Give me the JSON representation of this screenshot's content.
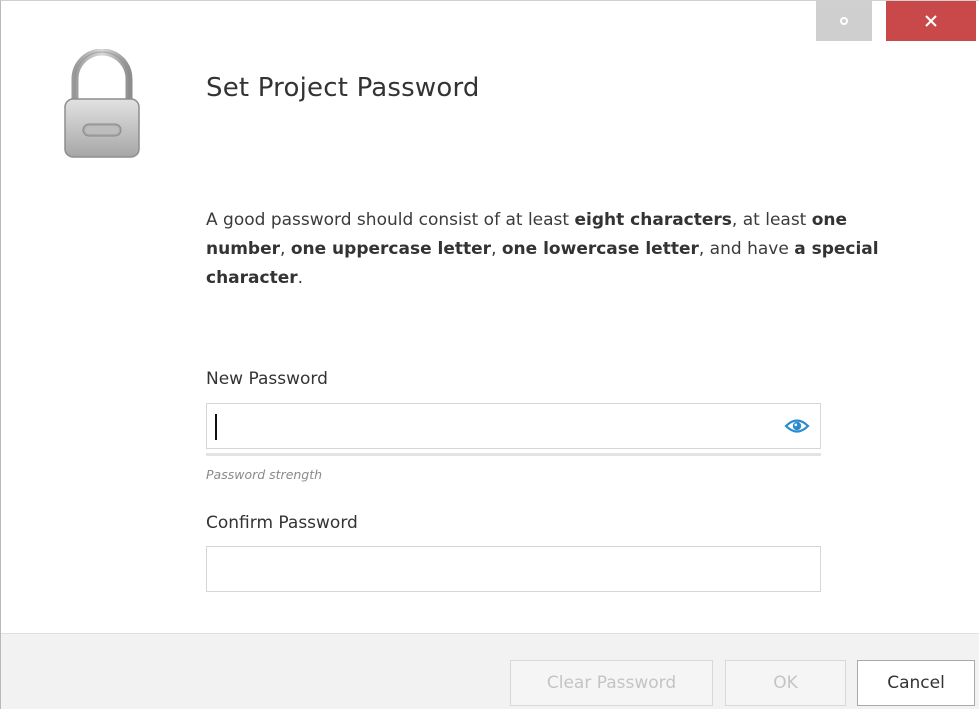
{
  "dialog": {
    "title": "Set Project Password",
    "description": {
      "p1": "A good password should consist of at least ",
      "b1": "eight characters",
      "p2": ", at least ",
      "b2": "one number",
      "p3": ", ",
      "b3": "one uppercase letter",
      "p4": ", ",
      "b4": "one lowercase letter",
      "p5": ", and have ",
      "b5": "a special character",
      "p6": "."
    },
    "fields": {
      "new_password": {
        "label": "New Password",
        "value": "",
        "strength_text": "Password strength"
      },
      "confirm_password": {
        "label": "Confirm Password",
        "value": ""
      }
    },
    "buttons": {
      "clear_password": "Clear Password",
      "ok": "OK",
      "cancel": "Cancel"
    },
    "window_controls": {
      "restore_icon": "circle-icon",
      "close_icon": "close-icon"
    },
    "icons": {
      "header": "padlock-icon",
      "reveal": "eye-icon"
    },
    "colors": {
      "close_button": "#c9494b",
      "restore_button": "#cfcfcf",
      "eye_icon": "#2a8ccf",
      "footer_bg": "#f2f2f2"
    }
  }
}
